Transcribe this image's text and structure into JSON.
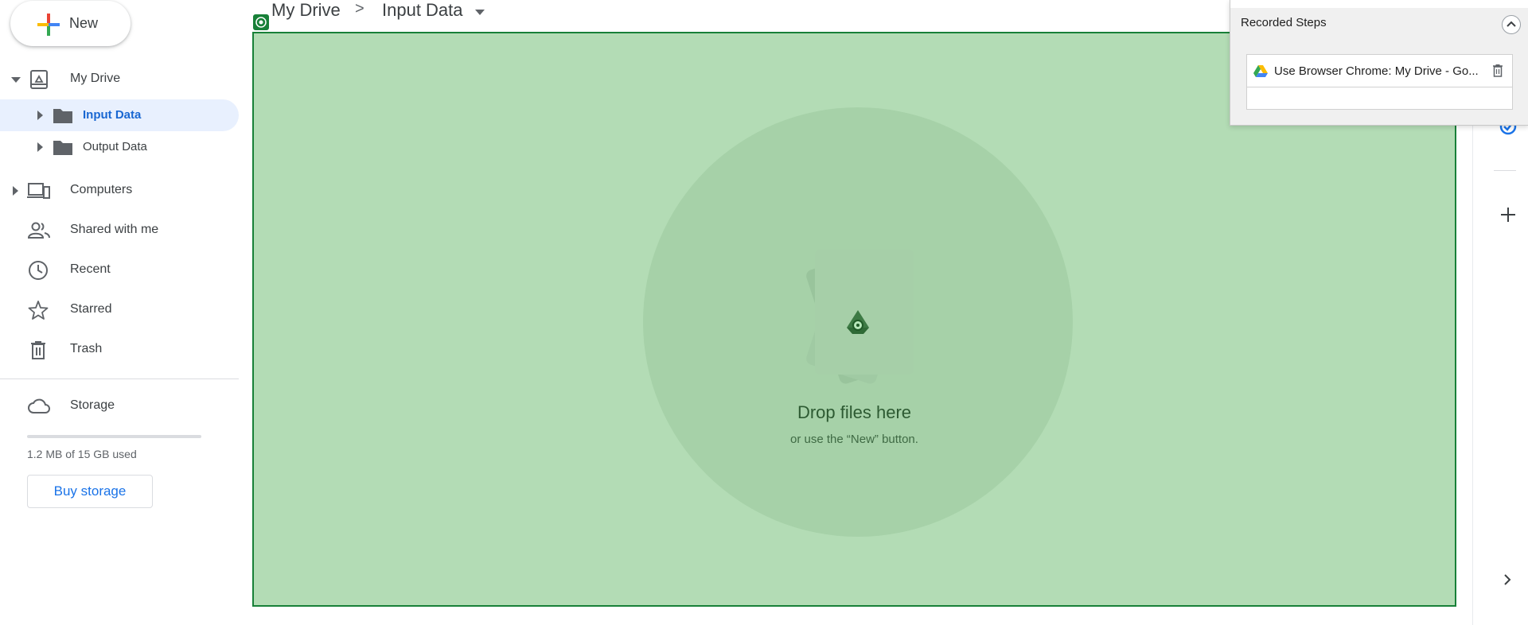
{
  "sidebar": {
    "new_label": "New",
    "tree": {
      "my_drive": "My Drive",
      "input_data": "Input Data",
      "output_data": "Output Data"
    },
    "items": [
      {
        "label": "Computers"
      },
      {
        "label": "Shared with me"
      },
      {
        "label": "Recent"
      },
      {
        "label": "Starred"
      },
      {
        "label": "Trash"
      }
    ],
    "storage": {
      "label": "Storage",
      "used_text": "1.2 MB of 15 GB used",
      "used_fraction": 0.0001,
      "buy_label": "Buy storage"
    }
  },
  "breadcrumb": {
    "root": "My Drive",
    "separator": ">",
    "current": "Input Data"
  },
  "drop_zone": {
    "title": "Drop files here",
    "subtitle": "or use the “New” button."
  },
  "recorder": {
    "title": "Recorded Steps",
    "steps": [
      {
        "label": "Use Browser Chrome: My Drive - Go..."
      }
    ]
  },
  "colors": {
    "accent": "#1a73e8",
    "drop_bg": "#b3dcb5",
    "drop_border": "#188038",
    "selected_bg": "#e8f0fe"
  }
}
